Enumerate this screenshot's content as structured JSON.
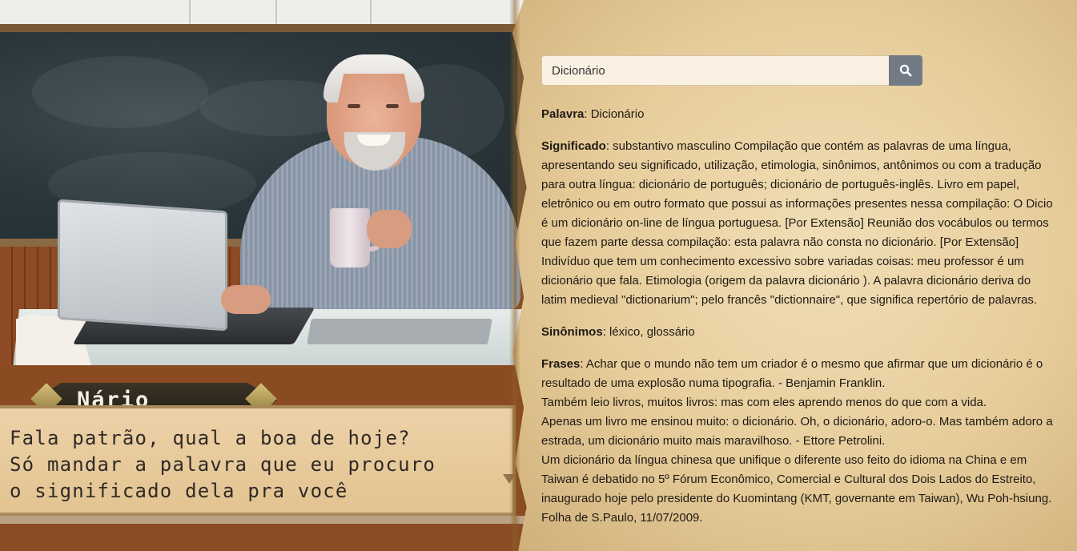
{
  "character": {
    "name": "Nário",
    "dialogue_lines": [
      "Fala patrão, qual a boa de hoje?",
      "Só mandar a palavra que eu procuro",
      "o significado dela pra você"
    ]
  },
  "search": {
    "value": "Dicionário",
    "button_icon": "search-icon"
  },
  "entry": {
    "palavra_label": "Palavra",
    "palavra_value": ": Dicionário",
    "significado_label": "Significado",
    "significado_value": ": substantivo masculino Compilação que contém as palavras de uma língua, apresentando seu significado, utilização, etimologia, sinônimos, antônimos ou com a tradução para outra língua: dicionário de português; dicionário de português-inglês. Livro em papel, eletrônico ou em outro formato que possui as informações presentes nessa compilação: O Dicio é um dicionário on-line de língua portuguesa. [Por Extensão] Reunião dos vocábulos ou termos que fazem parte dessa compilação: esta palavra não consta no dicionário. [Por Extensão] Indivíduo que tem um conhecimento excessivo sobre variadas coisas: meu professor é um dicionário que fala. Etimologia (origem da palavra dicionário ). A palavra dicionário deriva do latim medieval \"dictionarium\"; pelo francês \"dictionnaire\", que significa repertório de palavras.",
    "sinonimos_label": "Sinônimos",
    "sinonimos_value": ": léxico, glossário",
    "frases_label": "Frases",
    "frases_value": ": Achar que o mundo não tem um criador é o mesmo que afirmar que um dicionário é o resultado de uma explosão numa tipografia. - Benjamin Franklin.",
    "frases_extra": [
      "Também leio livros, muitos livros: mas com eles aprendo menos do que com a vida.",
      "Apenas um livro me ensinou muito: o dicionário. Oh, o dicionário, adoro-o. Mas também adoro a estrada, um dicionário muito mais maravilhoso. - Ettore Petrolini.",
      "Um dicionário da língua chinesa que unifique o diferente uso feito do idioma na China e em Taiwan é debatido no 5º Fórum Econômico, Comercial e Cultural dos Dois Lados do Estreito, inaugurado hoje pelo presidente do Kuomintang (KMT, governante em Taiwan), Wu Poh-hsiung. Folha de S.Paulo, 11/07/2009."
    ]
  },
  "colors": {
    "search_button": "#727a86",
    "parchment": "#e6cc9a",
    "dialog_box": "#ecd2a8",
    "name_plate": "#2f2a1f"
  }
}
